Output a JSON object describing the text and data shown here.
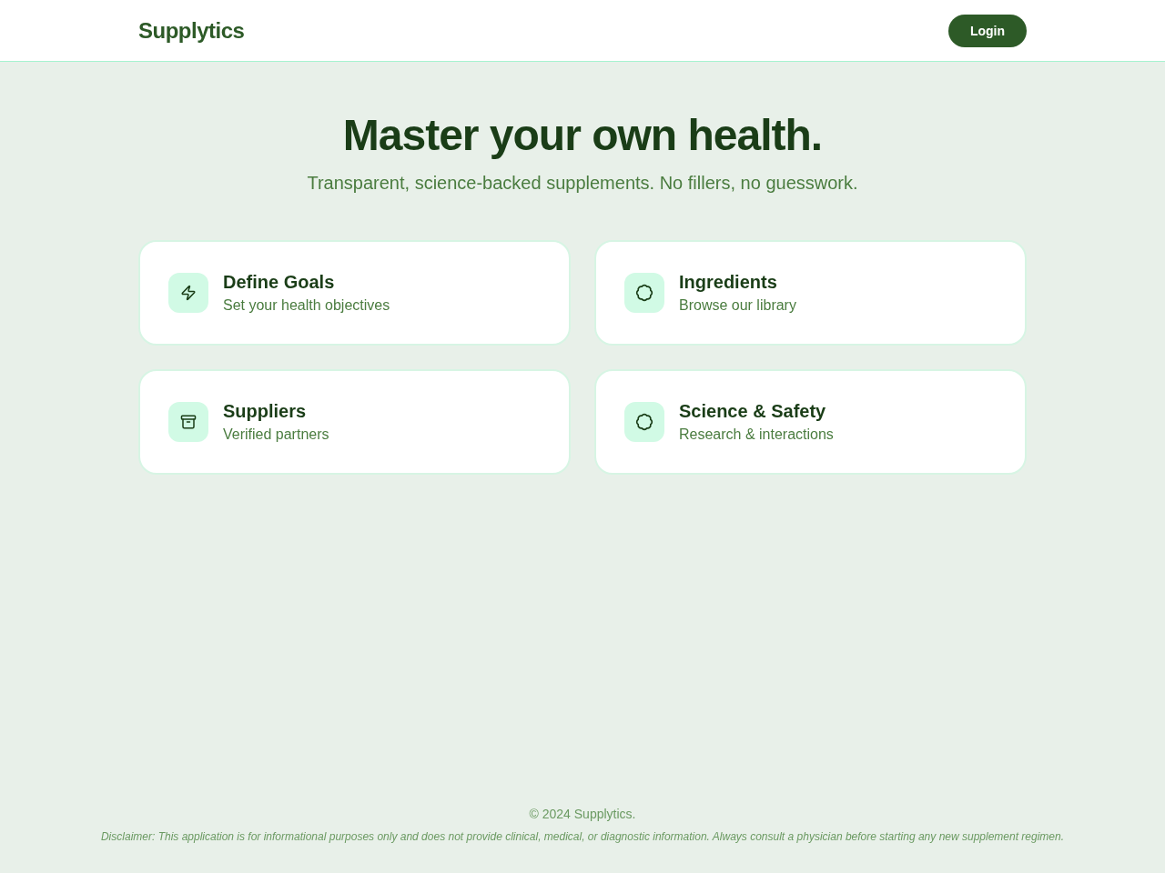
{
  "header": {
    "logo": "Supplytics",
    "login_button": "Login"
  },
  "hero": {
    "title": "Master your own health.",
    "subtitle": "Transparent, science-backed supplements. No fillers, no guesswork."
  },
  "cards": [
    {
      "kind": "goals",
      "title": "Define Goals",
      "subtitle": "Set your health objectives"
    },
    {
      "kind": "library",
      "title": "Ingredients",
      "subtitle": "Browse our library"
    },
    {
      "kind": "partners",
      "title": "Suppliers",
      "subtitle": "Verified partners"
    },
    {
      "kind": "library",
      "title": "Science & Safety",
      "subtitle": "Research & interactions"
    }
  ],
  "footer": {
    "copyright": "© 2024 Supplytics.",
    "disclaimer": "Disclaimer: This application is for informational purposes only and does not provide clinical, medical, or diagnostic information. Always consult a physician before starting any new supplement regimen."
  }
}
